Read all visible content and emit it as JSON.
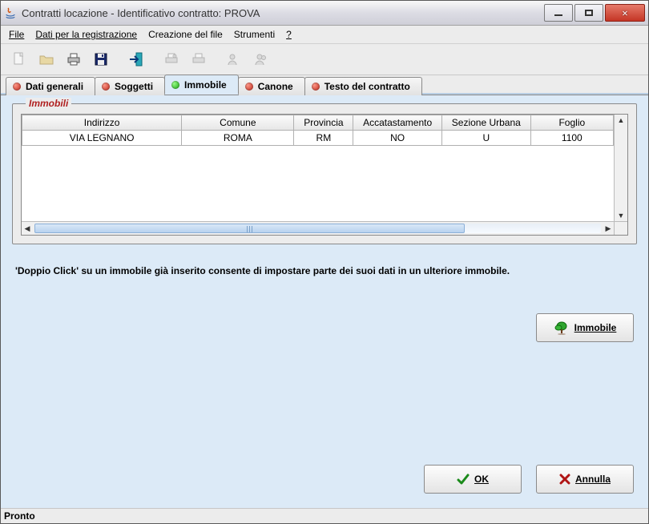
{
  "titlebar": {
    "title": "Contratti locazione - Identificativo contratto: PROVA"
  },
  "menubar": {
    "file": "File",
    "dati": "Dati per la registrazione",
    "creazione": "Creazione del file",
    "strumenti": "Strumenti",
    "help": "?"
  },
  "tabs": {
    "dati_generali": "Dati generali",
    "soggetti": "Soggetti",
    "immobile": "Immobile",
    "canone": "Canone",
    "testo": "Testo del contratto",
    "active_index": 2
  },
  "group": {
    "title": "Immobili"
  },
  "table": {
    "headers": [
      "Indirizzo",
      "Comune",
      "Provincia",
      "Accatastamento",
      "Sezione Urbana",
      "Foglio"
    ],
    "rows": [
      {
        "indirizzo": "VIA LEGNANO",
        "comune": "ROMA",
        "provincia": "RM",
        "accatastamento": "NO",
        "sezione": "U",
        "foglio": "1100"
      }
    ]
  },
  "hint": "'Doppio Click' su un immobile già inserito consente di impostare parte dei suoi dati in un ulteriore immobile.",
  "buttons": {
    "immobile": "Immobile",
    "ok": "OK",
    "annulla": "Annulla"
  },
  "status": "Pronto"
}
